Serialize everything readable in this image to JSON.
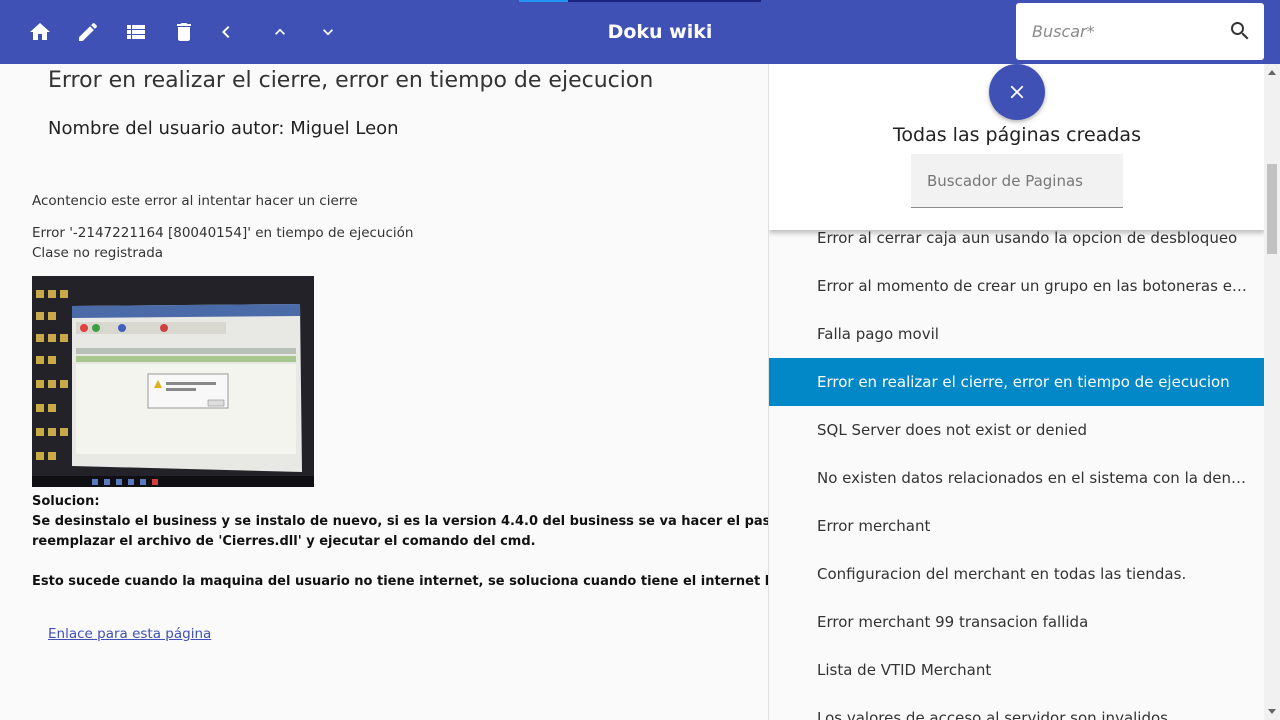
{
  "app": {
    "title": "Doku wiki",
    "search_placeholder": "Buscar*"
  },
  "toolbar": {
    "icons": [
      "home-icon",
      "edit-icon",
      "list-icon",
      "delete-icon",
      "back-icon",
      "chevron-up-icon",
      "chevron-down-icon"
    ]
  },
  "article": {
    "title": "Error en realizar el cierre, error en tiempo de ejecucion",
    "author": "Nombre del usuario autor: Miguel Leon",
    "intro": "Acontencio este error al intentar hacer un cierre",
    "error_line1": "Error '-2147221164 [80040154]' en tiempo de ejecución",
    "error_line2": "Clase no registrada",
    "solution_label": "Solucion:",
    "solution_line1": "Se desinstalo el business y se instalo de nuevo, si es la version 4.4.0 del business se va hacer el paso de",
    "solution_line2": "reemplazar el archivo de 'Cierres.dll' y ejecutar el comando del cmd.",
    "solution_line3": "Esto sucede cuando la maquina del usuario no tiene internet, se soluciona cuando tiene el internet la pc",
    "link_text": "Enlace para esta página"
  },
  "panel": {
    "title": "Todas las páginas creadas",
    "search_placeholder": "Buscador de Paginas",
    "items": [
      "Error al cerrar caja aun usando la opcion de desbloqueo",
      "Error al momento de crear un grupo en las botoneras e…",
      "Falla pago movil",
      "Error en realizar el cierre, error en tiempo de ejecucion",
      "SQL Server does not exist or denied",
      "No existen datos relacionados en el sistema con la den…",
      "Error merchant",
      "Configuracion del merchant en todas las tiendas.",
      "Error merchant 99 transacion fallida",
      "Lista de VTID Merchant",
      "Los valores de acceso al servidor son invalidos"
    ],
    "active_index": 3
  },
  "colors": {
    "primary": "#3f51b5",
    "active_item": "#0288c7"
  }
}
